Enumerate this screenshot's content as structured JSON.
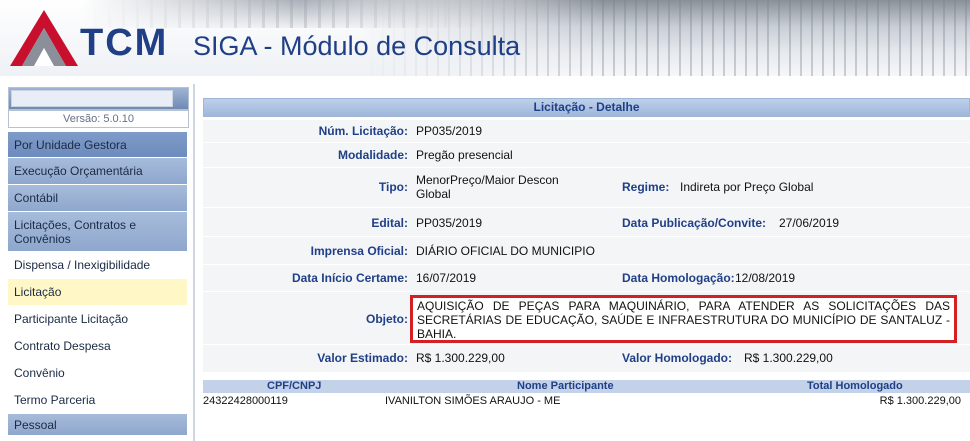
{
  "header": {
    "brand": "TCM",
    "app_title": "SIGA - Módulo de Consulta"
  },
  "sidebar": {
    "version": "Versão: 5.0.10",
    "items": [
      {
        "label": "Por Unidade Gestora",
        "kind": "section-active"
      },
      {
        "label": "Execução Orçamentária",
        "kind": "section"
      },
      {
        "label": "Contábil",
        "kind": "section"
      },
      {
        "label": "Licitações, Contratos e Convênios",
        "kind": "section"
      },
      {
        "label": "Dispensa / Inexigibilidade",
        "kind": "sub"
      },
      {
        "label": "Licitação",
        "kind": "sub-selected"
      },
      {
        "label": "Participante Licitação",
        "kind": "sub"
      },
      {
        "label": "Contrato Despesa",
        "kind": "sub"
      },
      {
        "label": "Convênio",
        "kind": "sub"
      },
      {
        "label": "Termo Parceria",
        "kind": "sub"
      },
      {
        "label": "Pessoal",
        "kind": "section"
      }
    ]
  },
  "detail": {
    "title": "Licitação - Detalhe",
    "num_licitacao": {
      "label": "Núm. Licitação:",
      "value": "PP035/2019"
    },
    "modalidade": {
      "label": "Modalidade:",
      "value": "Pregão presencial"
    },
    "tipo": {
      "label": "Tipo:",
      "value_line1": "MenorPreço/Maior Descon",
      "value_line2": "Global"
    },
    "regime": {
      "label": "Regime:",
      "value": "Indireta por Preço Global"
    },
    "edital": {
      "label": "Edital:",
      "value": "PP035/2019"
    },
    "data_publicacao": {
      "label": "Data Publicação/Convite:",
      "value": "27/06/2019"
    },
    "imprensa": {
      "label": "Imprensa Oficial:",
      "value": "DIÁRIO OFICIAL DO MUNICIPIO"
    },
    "data_inicio": {
      "label": "Data Início Certame:",
      "value": "16/07/2019"
    },
    "data_homologacao": {
      "label": "Data Homologação:",
      "value": "12/08/2019"
    },
    "objeto": {
      "label": "Objeto:",
      "value": "AQUISIÇÃO DE PEÇAS PARA MAQUINÁRIO, PARA ATENDER AS SOLICITAÇÕES DAS SECRETÁRIAS DE EDUCAÇÃO, SAÚDE E INFRAESTRUTURA DO MUNICÍPIO DE SANTALUZ - BAHIA."
    },
    "valor_estimado": {
      "label": "Valor Estimado:",
      "value": "R$ 1.300.229,00"
    },
    "valor_homologado": {
      "label": "Valor Homologado:",
      "value": "R$ 1.300.229,00"
    }
  },
  "participants": {
    "columns": [
      "CPF/CNPJ",
      "Nome Participante",
      "Total Homologado"
    ],
    "rows": [
      {
        "cpf": "24322428000119",
        "nome": "IVANILTON SIMÕES ARAUJO - ME",
        "total": "R$ 1.300.229,00"
      }
    ]
  },
  "colors": {
    "accent": "#1f3f86",
    "highlight_border": "#d41f25",
    "selected_item": "#fff8c6"
  }
}
